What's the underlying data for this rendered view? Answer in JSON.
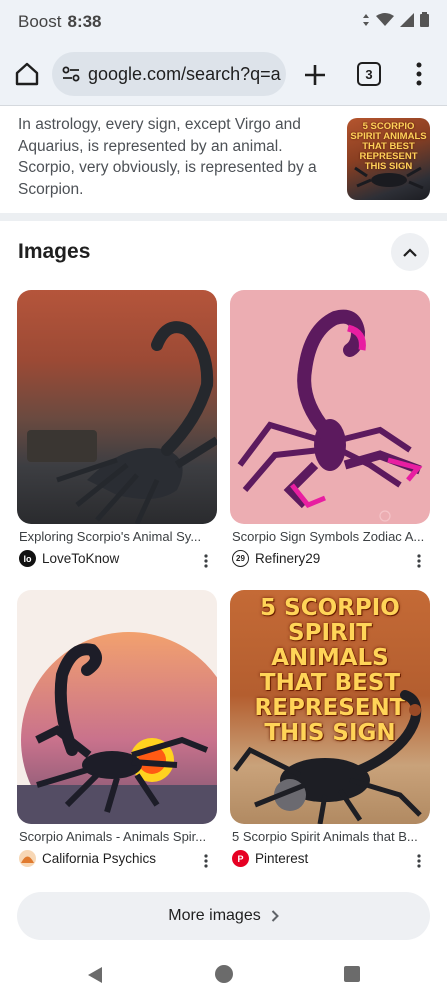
{
  "status_bar": {
    "carrier": "Boost",
    "time": "8:38"
  },
  "browser": {
    "url": "google.com/search?q=a",
    "tab_count": "3"
  },
  "snippet": {
    "text": "In astrology, every sign, except Virgo and Aquarius, is represented by an animal. Scorpio, very obviously, is represented by a Scorpion.",
    "thumb_text": "5 SCORPIO SPIRIT ANIMALS THAT BEST REPRESENT THIS SIGN"
  },
  "images_section": {
    "title": "Images",
    "cards": [
      {
        "title": "Exploring Scorpio's Animal Sy...",
        "source": "LoveToKnow",
        "source_icon": "lovetoknow-icon",
        "icon_color": "#111111",
        "icon_glyph": "lo"
      },
      {
        "title": "Scorpio Sign Symbols Zodiac A...",
        "source": "Refinery29",
        "source_icon": "refinery29-icon",
        "icon_color": "#222222",
        "icon_glyph": "29"
      },
      {
        "title": "Scorpio Animals - Animals Spir...",
        "source": "California Psychics",
        "source_icon": "california-psychics-icon",
        "icon_color": "#f2a65a",
        "icon_glyph": ""
      },
      {
        "title": "5 Scorpio Spirit Animals that B...",
        "source": "Pinterest",
        "source_icon": "pinterest-icon",
        "icon_color": "#e60023",
        "icon_glyph": "P"
      }
    ],
    "card4_overlay_text": "5 SCORPIO SPIRIT ANIMALS THAT BEST REPRESENT THIS SIGN",
    "more_images_label": "More images"
  },
  "colors": {
    "accent": "#1a73e8",
    "surface": "#eef2f7",
    "pink_bg": "#ecadb2",
    "scorpion_purple": "#5c1a5e",
    "scorpion_magenta": "#e81ea1"
  }
}
